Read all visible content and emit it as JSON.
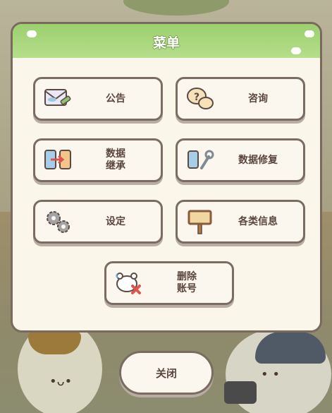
{
  "menu": {
    "title": "菜单",
    "buttons": {
      "notice": {
        "label": "公告",
        "icon": "envelope-pencil-icon"
      },
      "inquiry": {
        "label": "咨询",
        "icon": "question-bubble-icon"
      },
      "data_transfer": {
        "label": "数据\n继承",
        "icon": "phone-transfer-icon"
      },
      "data_repair": {
        "label": "数据修复",
        "icon": "phone-wrench-icon"
      },
      "settings": {
        "label": "设定",
        "icon": "gears-icon"
      },
      "info": {
        "label": "各类信息",
        "icon": "signboard-icon"
      },
      "delete_account": {
        "label": "删除\n账号",
        "icon": "account-delete-icon"
      }
    },
    "close_label": "关闭"
  },
  "colors": {
    "header_green": "#9ccf6f",
    "panel_bg": "#faf6ea",
    "border_brown": "#7b6c62",
    "text_brown": "#5a463e",
    "delete_red": "#e0524e"
  }
}
